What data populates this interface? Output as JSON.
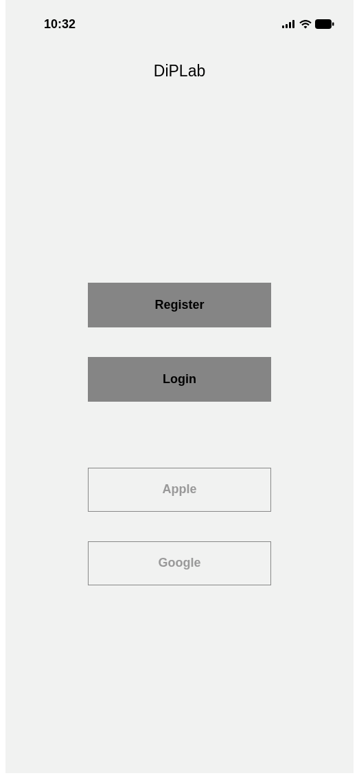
{
  "status_bar": {
    "time": "10:32"
  },
  "title": "DiPLab",
  "buttons": [
    {
      "label": "Register",
      "kind": "filled"
    },
    {
      "label": "Login",
      "kind": "filled"
    },
    {
      "label": "Apple",
      "kind": "outline"
    },
    {
      "label": "Google",
      "kind": "outline"
    }
  ]
}
